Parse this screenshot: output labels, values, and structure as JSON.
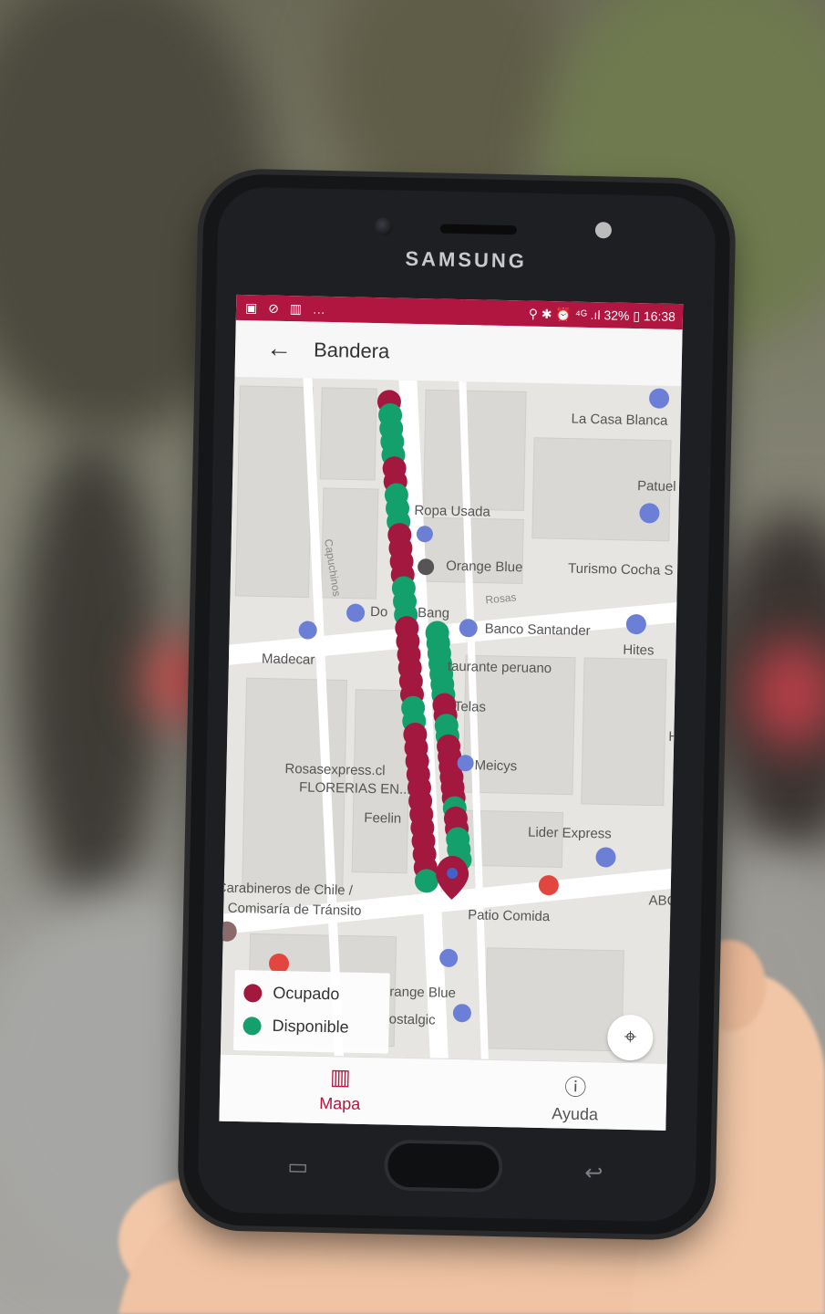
{
  "phone": {
    "brand": "SAMSUNG"
  },
  "status_bar": {
    "left_icons": "▣ ⊘ ▥ …",
    "right_text": "⚲ ✱ ⏰ ⁴ᴳ .ıl 32% ▯ 16:38"
  },
  "app_bar": {
    "back_icon": "←",
    "title": "Bandera"
  },
  "map": {
    "places": [
      "La Casa Blanca",
      "Patuel",
      "Ropa Usada",
      "Orange Blue",
      "Turismo Cocha S",
      "Rosas",
      "Capuchinos",
      "Do",
      "Bang",
      "Banco Santander",
      "Hites",
      "Madecar",
      "taurante peruano",
      "Telas",
      "Meicys",
      "Rosasexpress.cl",
      "FLORERIAS EN...",
      "Feelin",
      "Lider Express",
      "H",
      "Carabineros de Chile /",
      "2 Comisaría de Tránsito",
      "Patio Comida",
      "ABC",
      "range Blue",
      "ostalgic"
    ],
    "legend": [
      {
        "label": "Ocupado",
        "color": "#a3183f"
      },
      {
        "label": "Disponible",
        "color": "#14a06d"
      }
    ],
    "locate_icon": "⌖"
  },
  "bottom_nav": [
    {
      "label": "Mapa",
      "icon": "▥",
      "active": true,
      "color": "#b0163f"
    },
    {
      "label": "Ayuda",
      "icon": "ⓘ",
      "active": false,
      "color": "#555555"
    }
  ],
  "colors": {
    "accent": "#b0163f",
    "occupied": "#a3183f",
    "available": "#14a06d"
  }
}
